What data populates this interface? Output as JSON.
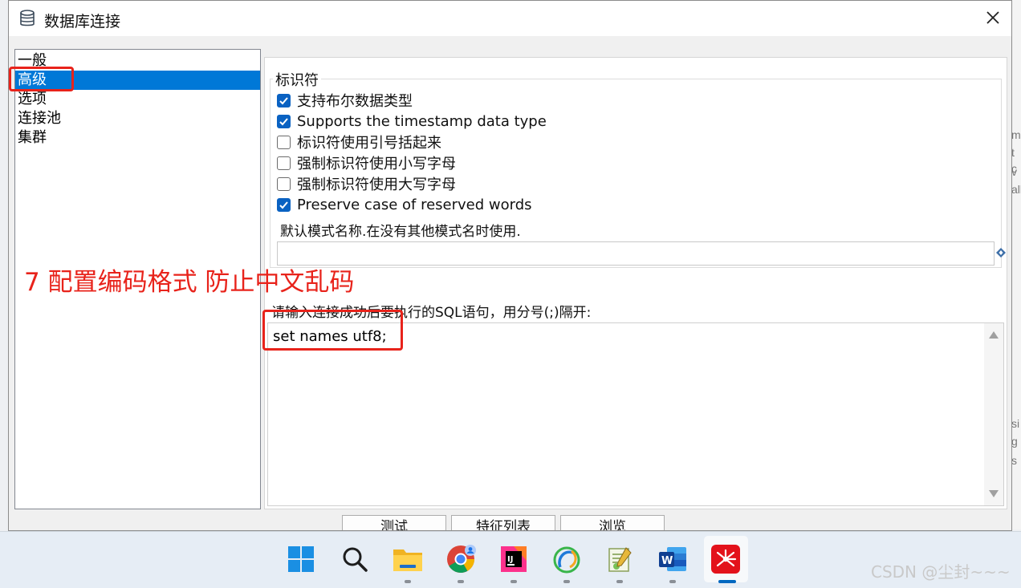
{
  "window": {
    "title": "数据库连接"
  },
  "nav": {
    "items": [
      {
        "label": "一般",
        "selected": false
      },
      {
        "label": "高级",
        "selected": true
      },
      {
        "label": "选项",
        "selected": false
      },
      {
        "label": "连接池",
        "selected": false
      },
      {
        "label": "集群",
        "selected": false
      }
    ]
  },
  "identifiers": {
    "group_label": "标识符",
    "options": [
      {
        "label": "支持布尔数据类型",
        "checked": true
      },
      {
        "label": "Supports the timestamp data type",
        "checked": true
      },
      {
        "label": "标识符使用引号括起来",
        "checked": false
      },
      {
        "label": "强制标识符使用小写字母",
        "checked": false
      },
      {
        "label": "强制标识符使用大写字母",
        "checked": false
      },
      {
        "label": "Preserve case of reserved words",
        "checked": true
      }
    ],
    "default_schema_label": "默认模式名称.在没有其他模式名时使用.",
    "default_schema_value": ""
  },
  "sql": {
    "label": "请输入连接成功后要执行的SQL语句，用分号(;)隔开:",
    "value": "set names utf8;"
  },
  "buttons": {
    "test": "测试",
    "feature_list": "特征列表",
    "browse": "浏览"
  },
  "annotation": {
    "text": "7 配置编码格式 防止中文乱码",
    "color": "#e8231b"
  },
  "background_window": {
    "fragments": [
      "m",
      "t c",
      "v",
      "all",
      "si",
      "g",
      "s"
    ]
  },
  "taskbar": {
    "icons": [
      "windows-start-icon",
      "search-icon",
      "file-explorer-icon",
      "chrome-icon",
      "intellij-idea-icon",
      "navicat-icon",
      "notepad-icon",
      "word-icon",
      "xmind-icon"
    ],
    "active": "xmind-icon"
  },
  "watermark": "CSDN @尘封~~~",
  "colors": {
    "accent": "#0078d7",
    "checkbox": "#0a62c2"
  }
}
